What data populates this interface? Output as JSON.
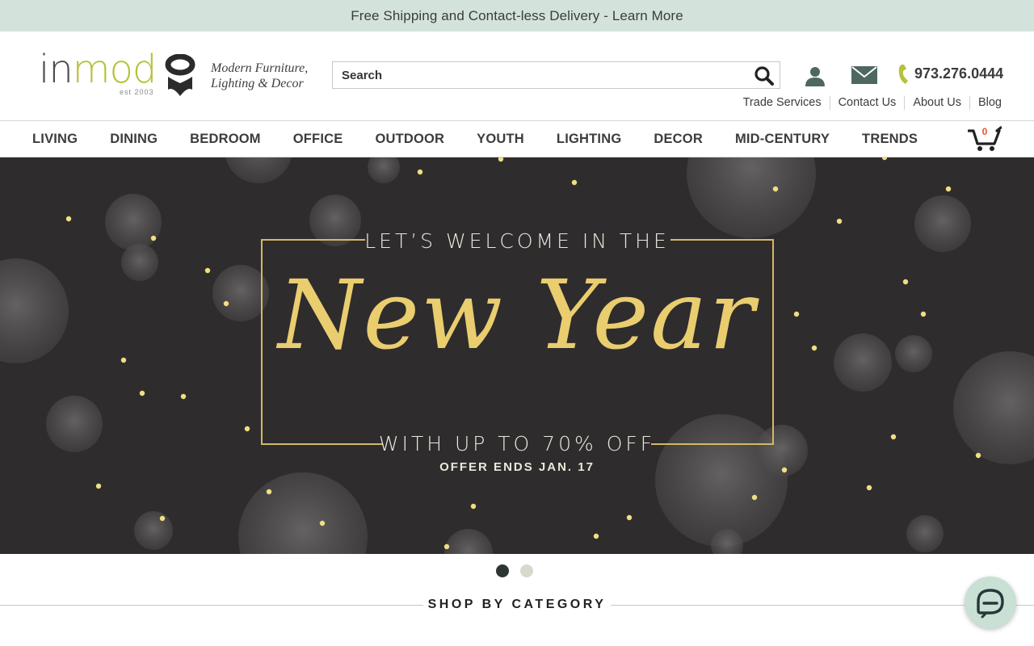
{
  "promo": {
    "text": "Free Shipping and Contact-less Delivery - Learn More"
  },
  "logo": {
    "word_in": "in",
    "word_mod": "mod",
    "est": "est 2003"
  },
  "tagline": {
    "line1": "Modern Furniture,",
    "line2": "Lighting & Decor"
  },
  "search": {
    "placeholder": "Search",
    "icon": "search-icon"
  },
  "header_icons": {
    "account": "user-icon",
    "email": "mail-icon",
    "phone": "phone-icon"
  },
  "phone": "973.276.0444",
  "utility_links": [
    "Trade Services",
    "Contact Us",
    "About Us",
    "Blog"
  ],
  "nav": [
    "LIVING",
    "DINING",
    "BEDROOM",
    "OFFICE",
    "OUTDOOR",
    "YOUTH",
    "LIGHTING",
    "DECOR",
    "MID-CENTURY",
    "TRENDS"
  ],
  "cart": {
    "count": "0",
    "icon": "cart-icon"
  },
  "hero": {
    "line1": "LET’S WELCOME IN THE",
    "headline": "New Year",
    "line2": "WITH UP TO 70% OFF",
    "line3": "OFFER ENDS JAN. 17"
  },
  "carousel": {
    "slides": 2,
    "active": 1
  },
  "section": {
    "title": "SHOP BY CATEGORY"
  },
  "chat": {
    "icon": "chat-icon"
  },
  "colors": {
    "promo_bg": "#d3e3dc",
    "logo_accent": "#b7c23a",
    "hero_bg": "#2f2c2d",
    "gold": "#e9cd6f",
    "cart_count": "#e4562a",
    "chat_bg": "#c9e0d4"
  }
}
